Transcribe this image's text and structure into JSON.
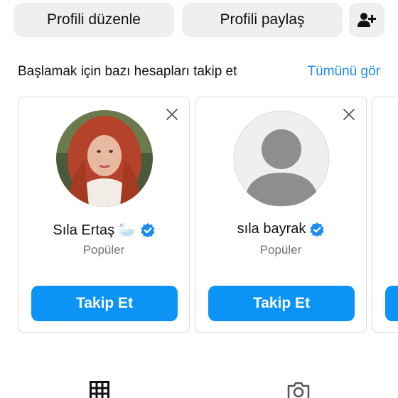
{
  "profile_actions": {
    "edit_label": "Profili düzenle",
    "share_label": "Profili paylaş",
    "add_person_icon": "person-add-icon"
  },
  "suggestions": {
    "title": "Başlamak için bazı hesapları takip et",
    "see_all": "Tümünü gör",
    "cards": [
      {
        "name": "Sıla Ertaş 🦢",
        "subtitle": "Popüler",
        "verified": true,
        "avatar": "photo",
        "button": "Takip Et"
      },
      {
        "name": "sıla bayrak",
        "subtitle": "Popüler",
        "verified": true,
        "avatar": "default-avatar",
        "button": "Takip Et"
      }
    ]
  },
  "tabs": {
    "grid_icon": "grid-icon",
    "tagged_icon": "camera-tag-icon"
  },
  "colors": {
    "accent": "#0b93f6",
    "link": "#1d8cf0",
    "verified": "#1d8cf0",
    "secondary_button": "#efefef",
    "muted_text": "#737373"
  }
}
